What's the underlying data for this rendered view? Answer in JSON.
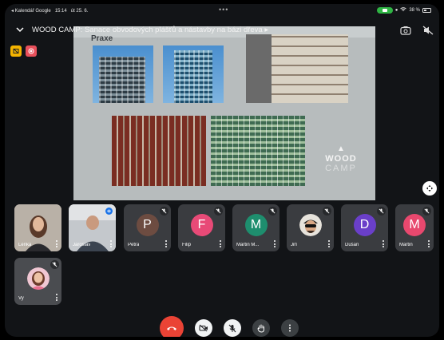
{
  "status_bar": {
    "back_app": "◂ Kalendář Google",
    "time": "15:14",
    "date": "út 25. 6.",
    "battery": "38 %"
  },
  "meeting": {
    "title": "WOOD CAMP: Sanace obvodových plášťů a nástavby na bázi dřeva ▸"
  },
  "presentation": {
    "heading": "Praxe",
    "logo_line1": "WOOD",
    "logo_line2": "CAMP"
  },
  "participants": [
    {
      "name": "Lenka",
      "type": "video"
    },
    {
      "name": "Jaroslav",
      "type": "video",
      "speaking": true
    },
    {
      "name": "Petra",
      "initial": "P",
      "color": "#6d4c41",
      "muted": true
    },
    {
      "name": "Filip",
      "initial": "F",
      "color": "#e84a77",
      "muted": true
    },
    {
      "name": "Martin M...",
      "initial": "M",
      "color": "#1e8e6e",
      "muted": true
    },
    {
      "name": "Jiří",
      "type": "avatar",
      "muted": true
    },
    {
      "name": "Dušan",
      "initial": "D",
      "color": "#6a3fc9",
      "muted": true
    },
    {
      "name": "Martin",
      "initial": "M",
      "color": "#e8486e",
      "muted": true
    },
    {
      "name": "Vy",
      "type": "avatar",
      "muted": true
    }
  ],
  "controls": {
    "hangup_color": "#ea4335"
  }
}
